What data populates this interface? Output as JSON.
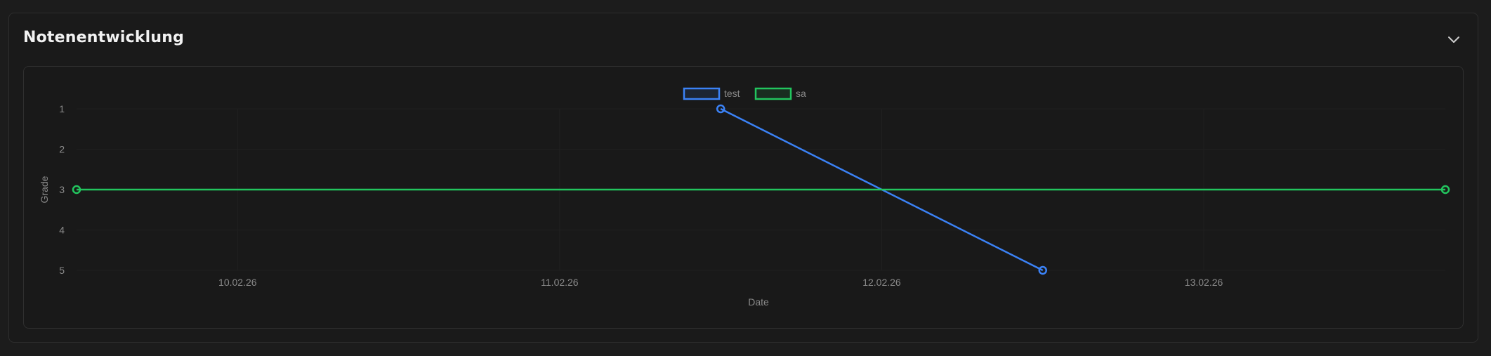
{
  "section": {
    "title": "Notenentwicklung",
    "collapse_icon": "chevron-down-icon"
  },
  "chart_data": {
    "type": "line",
    "xlabel": "Date",
    "ylabel": "Grade",
    "x_ticks": [
      "10.02.26",
      "11.02.26",
      "12.02.26",
      "13.02.26"
    ],
    "y_ticks": [
      1,
      2,
      3,
      4,
      5
    ],
    "ylim": [
      1,
      5
    ],
    "y_inverted": true,
    "xlim": [
      "2026-02-09 12:00",
      "2026-02-13 18:00"
    ],
    "legend_position": "top-center",
    "grid": true,
    "series": [
      {
        "name": "test",
        "color": "#3b82f6",
        "points": [
          {
            "x": "2026-02-11 12:00",
            "y": 1
          },
          {
            "x": "2026-02-12 12:00",
            "y": 5
          }
        ]
      },
      {
        "name": "sa",
        "color": "#22c55e",
        "points": [
          {
            "x": "2026-02-09 12:00",
            "y": 3
          },
          {
            "x": "2026-02-13 18:00",
            "y": 3
          }
        ]
      }
    ]
  }
}
